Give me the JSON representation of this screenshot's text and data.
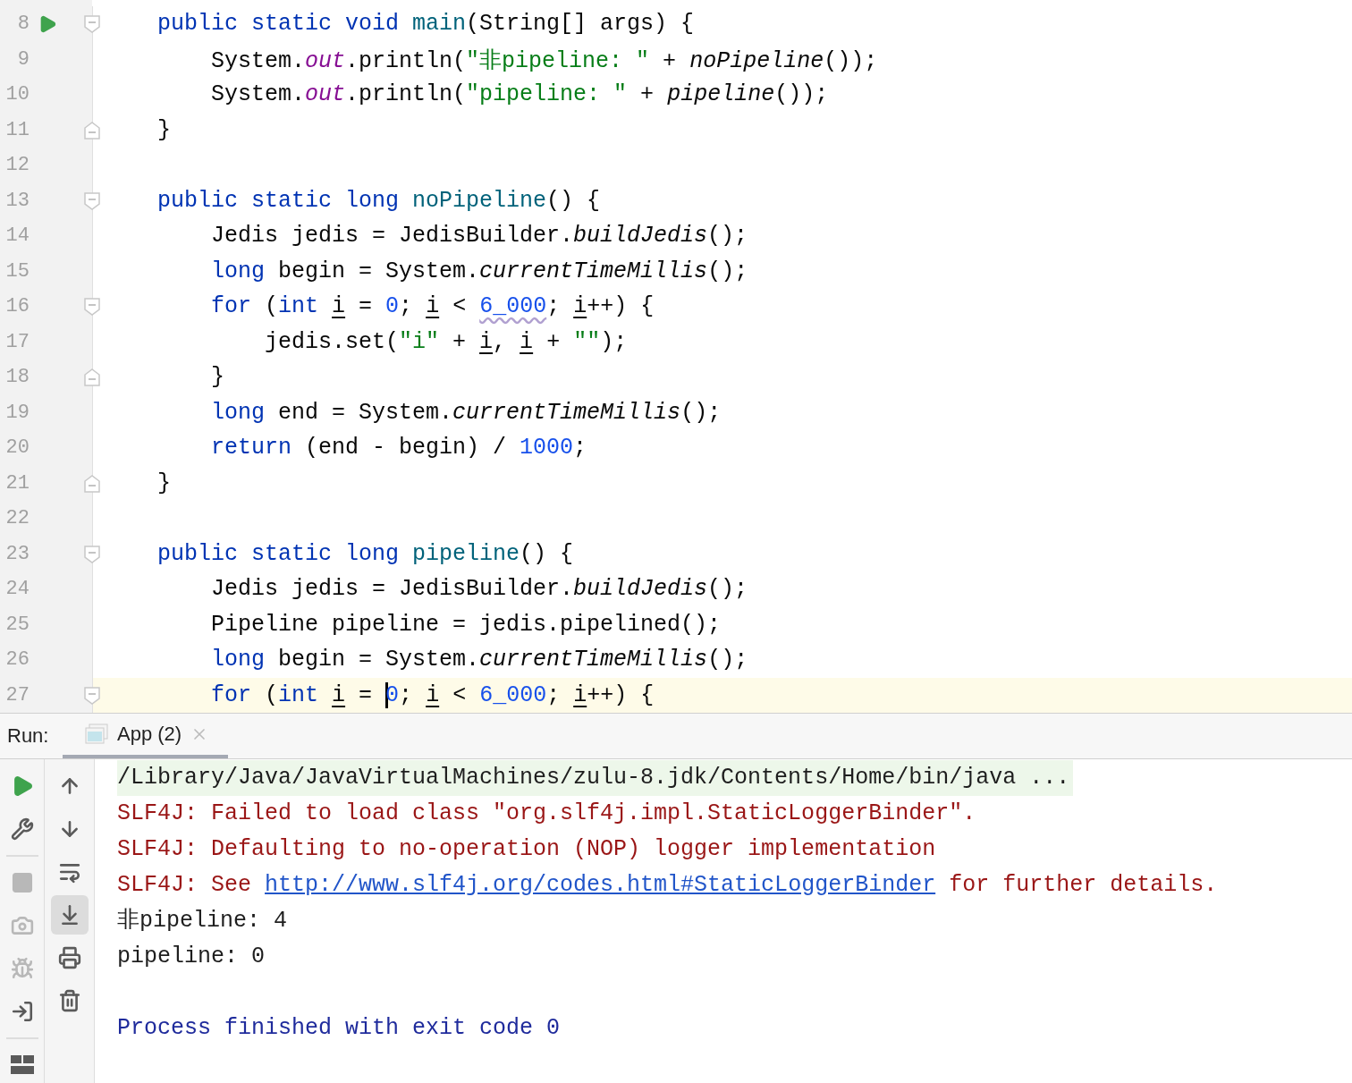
{
  "editor": {
    "lines": [
      {
        "number": "8",
        "run_marker": true,
        "fold_start": true,
        "fold_end": false,
        "current": false,
        "tokens": [
          {
            "t": "public static void ",
            "kind": "kw"
          },
          {
            "t": "main",
            "kind": "decl"
          },
          {
            "t": "(String[] args) {",
            "kind": "plain"
          }
        ]
      },
      {
        "number": "9",
        "run_marker": false,
        "fold_start": false,
        "fold_end": false,
        "current": false,
        "tokens": [
          {
            "t": "    System.",
            "kind": "plain"
          },
          {
            "t": "out",
            "kind": "field"
          },
          {
            "t": ".println(",
            "kind": "plain"
          },
          {
            "t": "\"非pipeline: \"",
            "kind": "str"
          },
          {
            "t": " + ",
            "kind": "plain"
          },
          {
            "t": "noPipeline",
            "kind": "static"
          },
          {
            "t": "());",
            "kind": "plain"
          }
        ]
      },
      {
        "number": "10",
        "run_marker": false,
        "fold_start": false,
        "fold_end": false,
        "current": false,
        "tokens": [
          {
            "t": "    System.",
            "kind": "plain"
          },
          {
            "t": "out",
            "kind": "field"
          },
          {
            "t": ".println(",
            "kind": "plain"
          },
          {
            "t": "\"pipeline: \"",
            "kind": "str"
          },
          {
            "t": " + ",
            "kind": "plain"
          },
          {
            "t": "pipeline",
            "kind": "static"
          },
          {
            "t": "());",
            "kind": "plain"
          }
        ]
      },
      {
        "number": "11",
        "run_marker": false,
        "fold_start": false,
        "fold_end": true,
        "current": false,
        "tokens": [
          {
            "t": "}",
            "kind": "plain"
          }
        ]
      },
      {
        "number": "12",
        "run_marker": false,
        "fold_start": false,
        "fold_end": false,
        "current": false
      },
      {
        "number": "13",
        "run_marker": false,
        "fold_start": true,
        "fold_end": false,
        "current": false,
        "tokens": [
          {
            "t": "public static long ",
            "kind": "kw"
          },
          {
            "t": "noPipeline",
            "kind": "decl"
          },
          {
            "t": "() {",
            "kind": "plain"
          }
        ]
      },
      {
        "number": "14",
        "run_marker": false,
        "fold_start": false,
        "fold_end": false,
        "current": false,
        "tokens": [
          {
            "t": "    Jedis jedis = JedisBuilder.",
            "kind": "plain"
          },
          {
            "t": "buildJedis",
            "kind": "static"
          },
          {
            "t": "();",
            "kind": "plain"
          }
        ]
      },
      {
        "number": "15",
        "run_marker": false,
        "fold_start": false,
        "fold_end": false,
        "current": false,
        "tokens": [
          {
            "t": "    long",
            "kind": "kw"
          },
          {
            "t": " begin = System.",
            "kind": "plain"
          },
          {
            "t": "currentTimeMillis",
            "kind": "static"
          },
          {
            "t": "();",
            "kind": "plain"
          }
        ]
      },
      {
        "number": "16",
        "run_marker": false,
        "fold_start": true,
        "fold_end": false,
        "current": false,
        "tokens": [
          {
            "t": "    for",
            "kind": "kw"
          },
          {
            "t": " (",
            "kind": "plain"
          },
          {
            "t": "int ",
            "kind": "kw"
          },
          {
            "t": "i",
            "kind": "var"
          },
          {
            "t": " = ",
            "kind": "plain"
          },
          {
            "t": "0",
            "kind": "num"
          },
          {
            "t": "; ",
            "kind": "plain"
          },
          {
            "t": "i",
            "kind": "var"
          },
          {
            "t": " < ",
            "kind": "plain"
          },
          {
            "t": "6_000",
            "kind": "numwarn"
          },
          {
            "t": "; ",
            "kind": "plain"
          },
          {
            "t": "i",
            "kind": "var"
          },
          {
            "t": "++) {",
            "kind": "plain"
          }
        ]
      },
      {
        "number": "17",
        "run_marker": false,
        "fold_start": false,
        "fold_end": false,
        "current": false,
        "tokens": [
          {
            "t": "        jedis.set(",
            "kind": "plain"
          },
          {
            "t": "\"i\"",
            "kind": "str"
          },
          {
            "t": " + ",
            "kind": "plain"
          },
          {
            "t": "i",
            "kind": "var"
          },
          {
            "t": ", ",
            "kind": "plain"
          },
          {
            "t": "i",
            "kind": "var"
          },
          {
            "t": " + ",
            "kind": "plain"
          },
          {
            "t": "\"\"",
            "kind": "str"
          },
          {
            "t": ");",
            "kind": "plain"
          }
        ]
      },
      {
        "number": "18",
        "run_marker": false,
        "fold_start": false,
        "fold_end": true,
        "current": false,
        "tokens": [
          {
            "t": "    }",
            "kind": "plain"
          }
        ]
      },
      {
        "number": "19",
        "run_marker": false,
        "fold_start": false,
        "fold_end": false,
        "current": false,
        "tokens": [
          {
            "t": "    long",
            "kind": "kw"
          },
          {
            "t": " end = System.",
            "kind": "plain"
          },
          {
            "t": "currentTimeMillis",
            "kind": "static"
          },
          {
            "t": "();",
            "kind": "plain"
          }
        ]
      },
      {
        "number": "20",
        "run_marker": false,
        "fold_start": false,
        "fold_end": false,
        "current": false,
        "tokens": [
          {
            "t": "    return",
            "kind": "kw"
          },
          {
            "t": " (end - begin) / ",
            "kind": "plain"
          },
          {
            "t": "1000",
            "kind": "num"
          },
          {
            "t": ";",
            "kind": "plain"
          }
        ]
      },
      {
        "number": "21",
        "run_marker": false,
        "fold_start": false,
        "fold_end": true,
        "current": false,
        "tokens": [
          {
            "t": "}",
            "kind": "plain"
          }
        ]
      },
      {
        "number": "22",
        "run_marker": false,
        "fold_start": false,
        "fold_end": false,
        "current": false
      },
      {
        "number": "23",
        "run_marker": false,
        "fold_start": true,
        "fold_end": false,
        "current": false,
        "tokens": [
          {
            "t": "public static long ",
            "kind": "kw"
          },
          {
            "t": "pipeline",
            "kind": "decl"
          },
          {
            "t": "() {",
            "kind": "plain"
          }
        ]
      },
      {
        "number": "24",
        "run_marker": false,
        "fold_start": false,
        "fold_end": false,
        "current": false,
        "tokens": [
          {
            "t": "    Jedis jedis = JedisBuilder.",
            "kind": "plain"
          },
          {
            "t": "buildJedis",
            "kind": "static"
          },
          {
            "t": "();",
            "kind": "plain"
          }
        ]
      },
      {
        "number": "25",
        "run_marker": false,
        "fold_start": false,
        "fold_end": false,
        "current": false,
        "tokens": [
          {
            "t": "    Pipeline pipeline = jedis.pipelined();",
            "kind": "plain"
          }
        ]
      },
      {
        "number": "26",
        "run_marker": false,
        "fold_start": false,
        "fold_end": false,
        "current": false,
        "tokens": [
          {
            "t": "    long",
            "kind": "kw"
          },
          {
            "t": " begin = System.",
            "kind": "plain"
          },
          {
            "t": "currentTimeMillis",
            "kind": "static"
          },
          {
            "t": "();",
            "kind": "plain"
          }
        ]
      },
      {
        "number": "27",
        "run_marker": false,
        "fold_start": true,
        "fold_end": false,
        "current": true,
        "tokens": [
          {
            "t": "    for",
            "kind": "kw"
          },
          {
            "t": " (",
            "kind": "plain"
          },
          {
            "t": "int ",
            "kind": "kw"
          },
          {
            "t": "i",
            "kind": "var"
          },
          {
            "t": " = ",
            "kind": "plain"
          },
          {
            "t": "0",
            "kind": "num",
            "caret": true
          },
          {
            "t": "; ",
            "kind": "plain"
          },
          {
            "t": "i",
            "kind": "var"
          },
          {
            "t": " < ",
            "kind": "plain"
          },
          {
            "t": "6_000",
            "kind": "num"
          },
          {
            "t": "; ",
            "kind": "plain"
          },
          {
            "t": "i",
            "kind": "var"
          },
          {
            "t": "++) {",
            "kind": "plain"
          }
        ]
      }
    ]
  },
  "run_panel": {
    "label": "Run:",
    "tabs": [
      {
        "label": "App (2)",
        "selected": true
      }
    ],
    "main_tools": [
      {
        "kind": "run",
        "disabled": false
      },
      {
        "kind": "settings",
        "disabled": false
      },
      {
        "kind": "divider"
      },
      {
        "kind": "stop",
        "disabled": true
      },
      {
        "kind": "snapshot",
        "disabled": true
      },
      {
        "kind": "debug",
        "disabled": true
      },
      {
        "kind": "import",
        "disabled": false
      },
      {
        "kind": "divider"
      },
      {
        "kind": "layout",
        "disabled": false
      }
    ],
    "console_tools": [
      {
        "kind": "up",
        "selected": false
      },
      {
        "kind": "down",
        "selected": false
      },
      {
        "kind": "wrap",
        "selected": false
      },
      {
        "kind": "scroll_end",
        "selected": true
      },
      {
        "kind": "print",
        "selected": false
      },
      {
        "kind": "clear",
        "selected": false
      }
    ],
    "console": [
      {
        "kind": "command",
        "spaced": false,
        "segments": [
          {
            "t": "/Library/Java/JavaVirtualMachines/zulu-8.jdk/Contents/Home/bin/java ...",
            "link": false
          }
        ]
      },
      {
        "kind": "error",
        "spaced": false,
        "segments": [
          {
            "t": "SLF4J: Failed to load class \"org.slf4j.impl.StaticLoggerBinder\".",
            "link": false
          }
        ]
      },
      {
        "kind": "error",
        "spaced": false,
        "segments": [
          {
            "t": "SLF4J: Defaulting to no-operation (NOP) logger implementation",
            "link": false
          }
        ]
      },
      {
        "kind": "error",
        "spaced": false,
        "segments": [
          {
            "t": "SLF4J: See ",
            "link": false
          },
          {
            "t": "http://www.slf4j.org/codes.html#StaticLoggerBinder",
            "link": true
          },
          {
            "t": " for further details.",
            "link": false
          }
        ]
      },
      {
        "kind": "output",
        "spaced": false,
        "segments": [
          {
            "t": "非pipeline: 4",
            "link": false
          }
        ]
      },
      {
        "kind": "output",
        "spaced": false,
        "segments": [
          {
            "t": "pipeline: 0",
            "link": false
          }
        ]
      },
      {
        "kind": "system",
        "spaced": true,
        "segments": [
          {
            "t": "Process finished with exit code 0",
            "link": false
          }
        ]
      }
    ]
  }
}
